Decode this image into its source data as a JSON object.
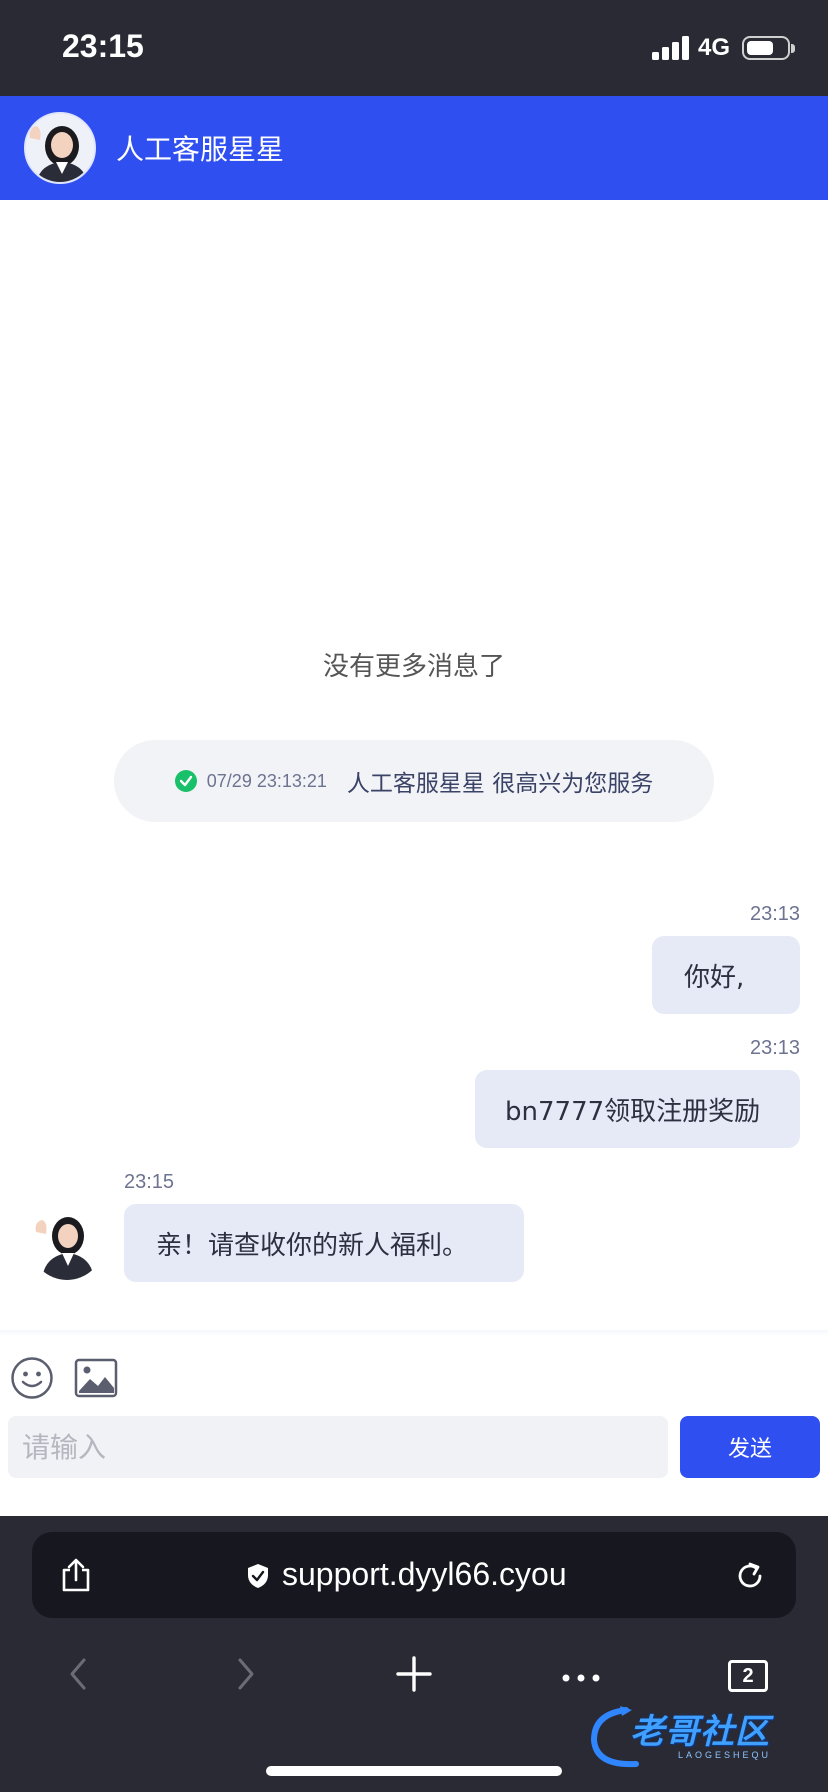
{
  "status_bar": {
    "time": "23:15",
    "network": "4G",
    "battery_level": 0.7
  },
  "header": {
    "title": "人工客服星星",
    "avatar_icon": "agent-avatar"
  },
  "chat": {
    "no_more_text": "没有更多消息了",
    "service_notice": {
      "time": "07/29 23:13:21",
      "text": "人工客服星星 很高兴为您服务"
    },
    "messages": [
      {
        "side": "right",
        "time": "23:13",
        "text": "你好,"
      },
      {
        "side": "right",
        "time": "23:13",
        "text": "bn7777领取注册奖励"
      },
      {
        "side": "left",
        "time": "23:15",
        "text": "亲！请查收你的新人福利。"
      }
    ]
  },
  "composer": {
    "placeholder": "请输入",
    "send_label": "发送",
    "emoji_icon": "smile-icon",
    "image_icon": "image-icon"
  },
  "browser": {
    "url": "support.dyyl66.cyou",
    "tab_count": "2"
  },
  "watermark": {
    "text": "老哥社区",
    "sub": "LAOGESHEQU"
  },
  "colors": {
    "accent": "#2f4ff0",
    "status_bar_bg": "#2a2a35",
    "bubble_bg": "#e6eaf6",
    "check_green": "#19c06a"
  }
}
